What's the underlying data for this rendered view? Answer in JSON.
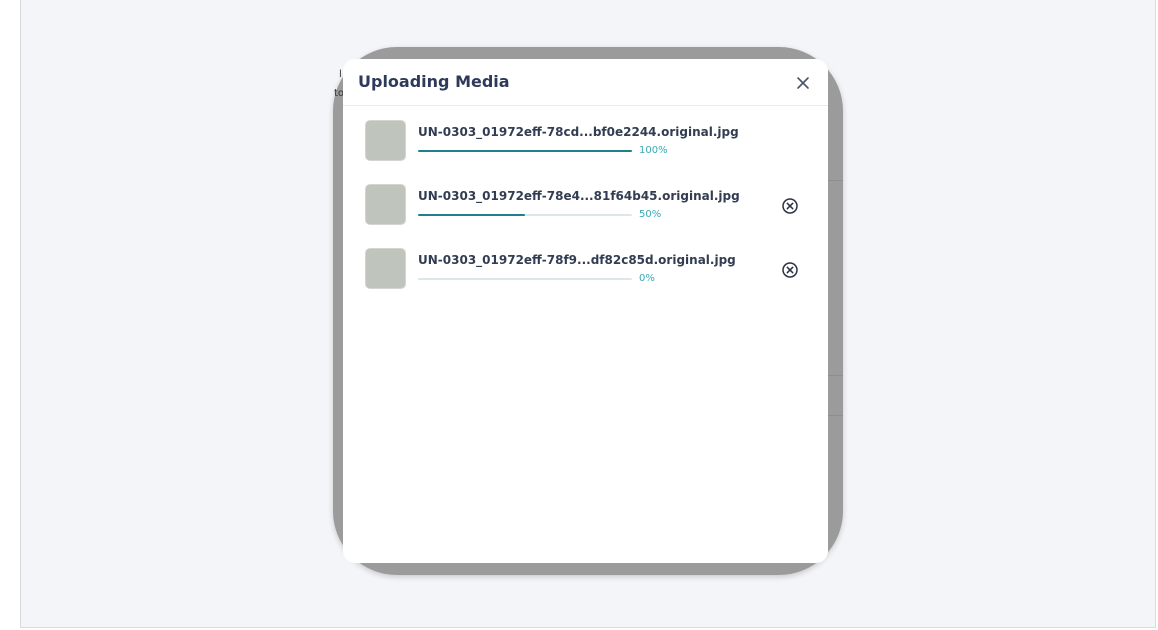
{
  "background": {
    "ghost_text_1": "l",
    "ghost_text_2": "to"
  },
  "modal": {
    "title": "Uploading Media",
    "close_icon": "close-icon",
    "uploads": [
      {
        "file_name": "UN-0303_01972eff-78cd...bf0e2244.original.jpg",
        "progress": 100,
        "percent_label": "100%",
        "cancelable": false
      },
      {
        "file_name": "UN-0303_01972eff-78e4...81f64b45.original.jpg",
        "progress": 50,
        "percent_label": "50%",
        "cancelable": true,
        "cancel_icon": "cancel-circle-icon"
      },
      {
        "file_name": "UN-0303_01972eff-78f9...df82c85d.original.jpg",
        "progress": 0,
        "percent_label": "0%",
        "cancelable": true,
        "cancel_icon": "cancel-circle-icon"
      }
    ]
  },
  "colors": {
    "progress_fill": "#1f7f8a",
    "progress_track": "#dde6e8",
    "percent_text": "#3aa8b4",
    "title_text": "#2e3a59"
  }
}
